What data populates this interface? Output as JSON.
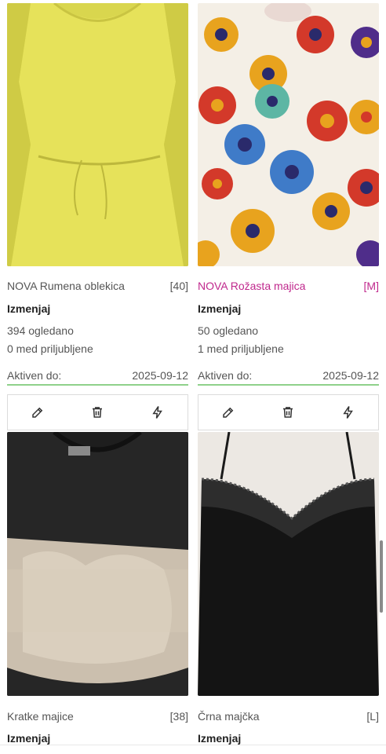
{
  "listings": [
    {
      "title": "NOVA Rumena oblekica",
      "size": "[40]",
      "edit_label": "Izmenjaj",
      "views": "394 ogledano",
      "favorites": "0 med priljubljene",
      "active_label": "Aktiven do:",
      "active_date": "2025-09-12",
      "image_desc": "yellow-dress"
    },
    {
      "title": "NOVA Rožasta majica",
      "size": "[M]",
      "edit_label": "Izmenjaj",
      "views": "50 ogledano",
      "favorites": "1 med priljubljene",
      "active_label": "Aktiven do:",
      "active_date": "2025-09-12",
      "image_desc": "floral-top",
      "accent": "#c0288d"
    },
    {
      "title": "Kratke majice",
      "size": "[38]",
      "edit_label": "Izmenjaj",
      "image_desc": "levis-tshirt"
    },
    {
      "title": "Črna majčka",
      "size": "[L]",
      "edit_label": "Izmenjaj",
      "image_desc": "black-lace-cami"
    }
  ],
  "actions": [
    "pencil-icon",
    "trash-icon",
    "bolt-icon"
  ],
  "colors": {
    "accent_pink": "#c0288d",
    "active_underline": "#8fd18b"
  }
}
